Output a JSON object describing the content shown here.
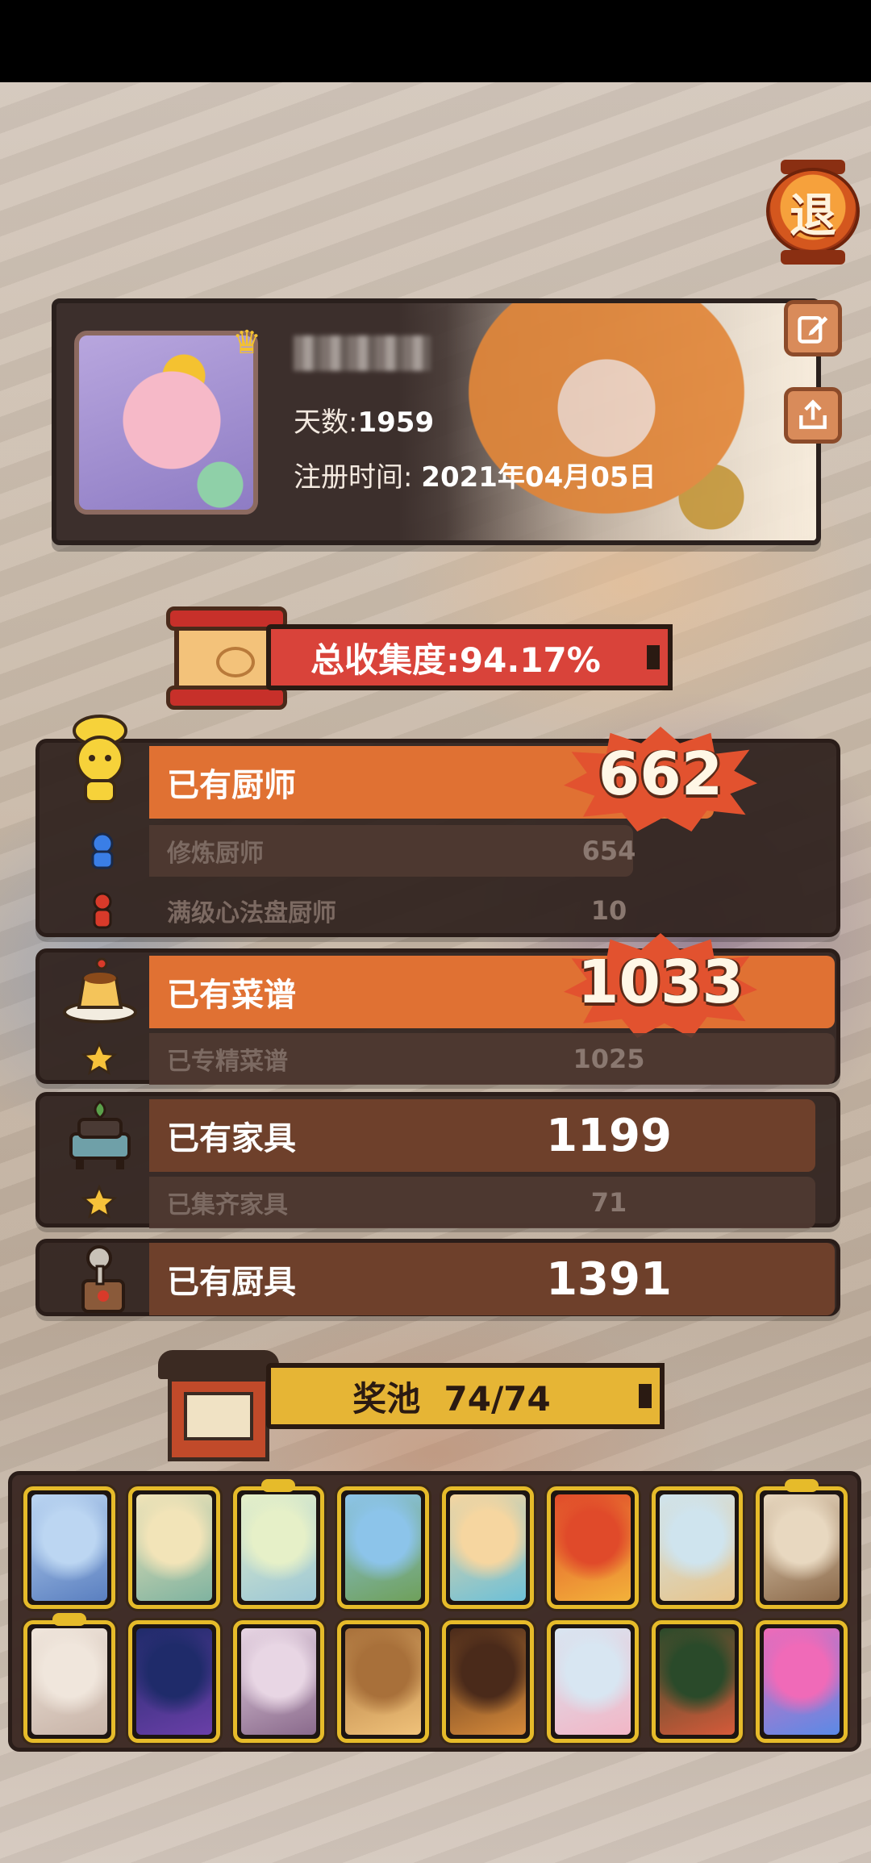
{
  "exit_button": {
    "label": "退"
  },
  "profile": {
    "days_label": "天数:",
    "days_value": "1959",
    "register_label": "注册时间:",
    "register_value": "2021年04月05日"
  },
  "collection": {
    "label": "总收集度:94.17%"
  },
  "chefs": {
    "label": "已有厨师",
    "value": "662",
    "sub": [
      {
        "label": "修炼厨师",
        "value": "654"
      },
      {
        "label": "满级心法盘厨师",
        "value": "10"
      }
    ]
  },
  "recipes": {
    "label": "已有菜谱",
    "value": "1033",
    "sub": [
      {
        "label": "已专精菜谱",
        "value": "1025"
      }
    ]
  },
  "furniture": {
    "label": "已有家具",
    "value": "1199",
    "sub": [
      {
        "label": "已集齐家具",
        "value": "71"
      }
    ]
  },
  "utensils": {
    "label": "已有厨具",
    "value": "1391"
  },
  "reward_pool": {
    "label": "奖池  74/74",
    "cards": [
      {
        "name": "pool-card-1",
        "colors": [
          "#bcd6f2",
          "#5a7fc0"
        ],
        "ribbon": false
      },
      {
        "name": "pool-card-2",
        "colors": [
          "#f2e4b8",
          "#7fb3a0"
        ],
        "ribbon": false
      },
      {
        "name": "pool-card-3",
        "colors": [
          "#e6f0c8",
          "#9cc7d6"
        ],
        "ribbon": true
      },
      {
        "name": "pool-card-4",
        "colors": [
          "#8cc4ea",
          "#6fa05a"
        ],
        "ribbon": false
      },
      {
        "name": "pool-card-5",
        "colors": [
          "#f6d6a0",
          "#6cc0d8"
        ],
        "ribbon": false
      },
      {
        "name": "pool-card-6",
        "colors": [
          "#e04a2a",
          "#f3b23a"
        ],
        "ribbon": false
      },
      {
        "name": "pool-card-7",
        "colors": [
          "#cfe4ee",
          "#e7c58c"
        ],
        "ribbon": false
      },
      {
        "name": "pool-card-8",
        "colors": [
          "#e8d8c0",
          "#8c6a4a"
        ],
        "ribbon": true
      },
      {
        "name": "pool-card-9",
        "colors": [
          "#f0e6dc",
          "#c8b4a8"
        ],
        "ribbon": true
      },
      {
        "name": "pool-card-10",
        "colors": [
          "#1f2b6a",
          "#6a3fa8"
        ],
        "ribbon": false
      },
      {
        "name": "pool-card-11",
        "colors": [
          "#e8d6e4",
          "#8a6a8c"
        ],
        "ribbon": false
      },
      {
        "name": "pool-card-12",
        "colors": [
          "#a8703a",
          "#f0c27a"
        ],
        "ribbon": false
      },
      {
        "name": "pool-card-13",
        "colors": [
          "#4a2a1a",
          "#d68a3a"
        ],
        "ribbon": false
      },
      {
        "name": "pool-card-14",
        "colors": [
          "#d8e6f2",
          "#f2b6c6"
        ],
        "ribbon": false
      },
      {
        "name": "pool-card-15",
        "colors": [
          "#2a4a2a",
          "#d65a3a"
        ],
        "ribbon": false
      },
      {
        "name": "pool-card-16",
        "colors": [
          "#f06ab8",
          "#5a8ae6"
        ],
        "ribbon": false
      }
    ]
  },
  "colors": {
    "accent_orange": "#e07133",
    "accent_brown": "#6e402b",
    "banner_red": "#d9433a",
    "banner_gold": "#e6b535",
    "card_frame": "#e6bb2a"
  }
}
